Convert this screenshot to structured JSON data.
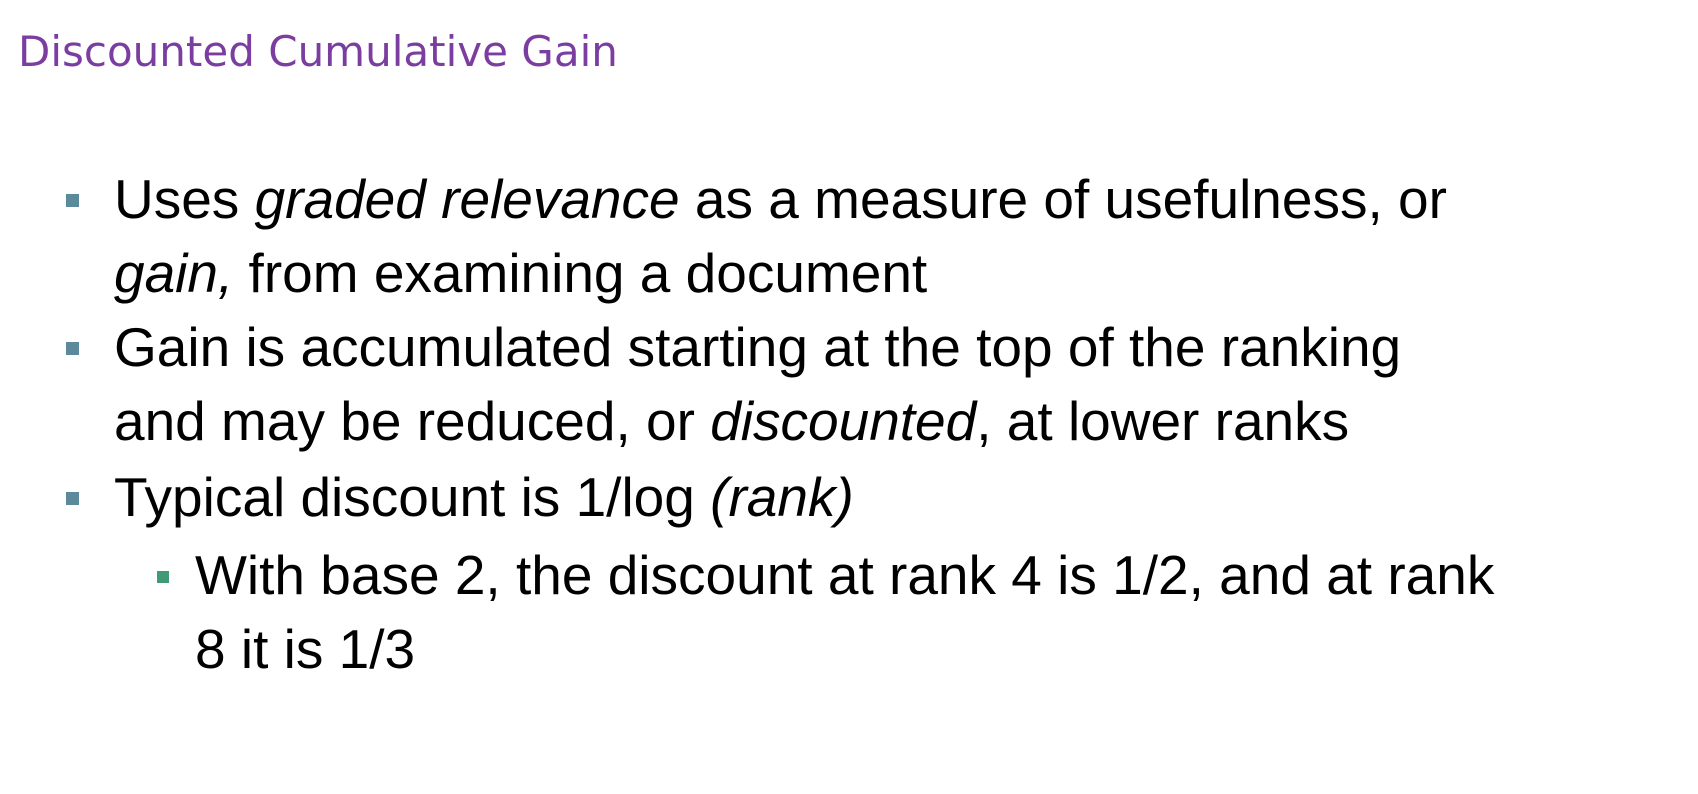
{
  "slide": {
    "title": "Discounted Cumulative Gain",
    "bullets": [
      {
        "level": 1,
        "lines": [
          [
            {
              "t": "Uses "
            },
            {
              "t": "graded relevance",
              "i": true
            },
            {
              "t": " as a measure of  usefulness, or"
            }
          ],
          [
            {
              "t": "gain,",
              "i": true
            },
            {
              "t": " from examining a document"
            }
          ]
        ]
      },
      {
        "level": 1,
        "lines": [
          [
            {
              "t": "Gain is accumulated starting at the top of the ranking"
            }
          ],
          [
            {
              "t": "and may be reduced, or "
            },
            {
              "t": "discounted",
              "i": true
            },
            {
              "t": ", at lower ranks"
            }
          ]
        ]
      },
      {
        "level": 1,
        "lines": [
          [
            {
              "t": "Typical discount is 1/log "
            },
            {
              "t": "(rank)",
              "i": true
            }
          ]
        ]
      },
      {
        "level": 2,
        "lines": [
          [
            {
              "t": "With base 2, the discount at rank 4 is 1/2, and at rank"
            }
          ],
          [
            {
              "t": "8 it is 1/3"
            }
          ]
        ]
      }
    ]
  }
}
